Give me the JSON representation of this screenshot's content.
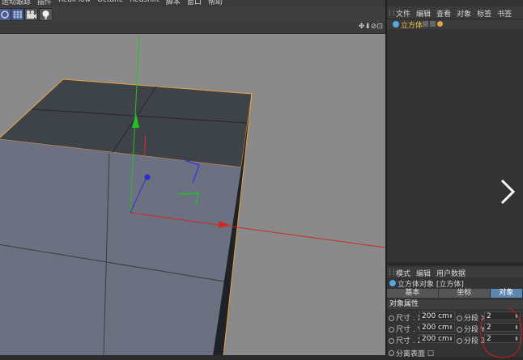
{
  "menubar": {
    "items": [
      "运动跟踪",
      "插件",
      "RealFlow",
      "Octane",
      "Redshift",
      "脚本",
      "窗口",
      "帮助"
    ]
  },
  "toolbar": {
    "icons": [
      "deformer-icon",
      "floor-grid-icon",
      "camera-icon",
      "light-icon"
    ]
  },
  "viewport_header": {
    "nav_icons": "✥⬇⊘⊡"
  },
  "object_manager": {
    "menu": [
      "文件",
      "编辑",
      "查看",
      "对象",
      "标签",
      "书签"
    ],
    "objects": [
      {
        "name": "立方体"
      }
    ]
  },
  "attributes": {
    "menu": [
      "模式",
      "编辑",
      "用户数据"
    ],
    "title": "立方体对象 [立方体]",
    "tabs": [
      {
        "label": "基本"
      },
      {
        "label": "坐标"
      },
      {
        "label": "对象",
        "active": true
      }
    ],
    "section": "对象属性",
    "size": [
      {
        "label": "尺寸 . X",
        "value": "200 cm"
      },
      {
        "label": "尺寸 . Y",
        "value": "200 cm"
      },
      {
        "label": "尺寸 . Z",
        "value": "200 cm"
      }
    ],
    "segments": [
      {
        "label": "分段 X",
        "value": "2"
      },
      {
        "label": "分段 Y",
        "value": "2"
      },
      {
        "label": "分段 Z",
        "value": "2"
      }
    ],
    "separate_surfaces": "分离表面 ☐"
  },
  "colors": {
    "viewport_bg": "#8a8a8a",
    "cube_top": "#3e4249",
    "cube_front": "#6b7180",
    "cube_side": "#1e2125",
    "selection_outline": "#e8a040",
    "x_axis": "#d22828",
    "y_axis": "#22c022",
    "z_axis": "#2a2ad8",
    "annotation": "#c81e1e"
  }
}
